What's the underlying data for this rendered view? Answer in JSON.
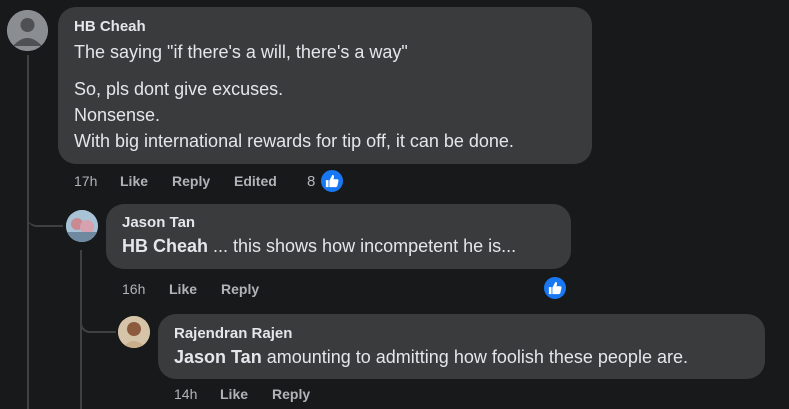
{
  "comments": [
    {
      "author": "HB Cheah",
      "lines": [
        "The saying \"if there's a will, there's a way\"",
        "So, pls dont give excuses.",
        "Nonsense.",
        "With big international rewards for tip off, it can be done."
      ],
      "time": "17h",
      "like_label": "Like",
      "reply_label": "Reply",
      "edited_label": "Edited",
      "reaction_count": "8"
    },
    {
      "author": "Jason Tan",
      "mention": "HB Cheah",
      "text": " ... this shows how incompetent he is...",
      "time": "16h",
      "like_label": "Like",
      "reply_label": "Reply"
    },
    {
      "author": "Rajendran Rajen",
      "mention": "Jason Tan",
      "text": " amounting to admitting how foolish these people are.",
      "time": "14h",
      "like_label": "Like",
      "reply_label": "Reply"
    }
  ],
  "colors": {
    "background": "#18191a",
    "bubble": "#3a3b3c",
    "like_blue": "#1877f2",
    "meta_text": "#b0b3b8"
  },
  "icons": [
    "default-avatar-icon",
    "thumbs-up-icon"
  ]
}
